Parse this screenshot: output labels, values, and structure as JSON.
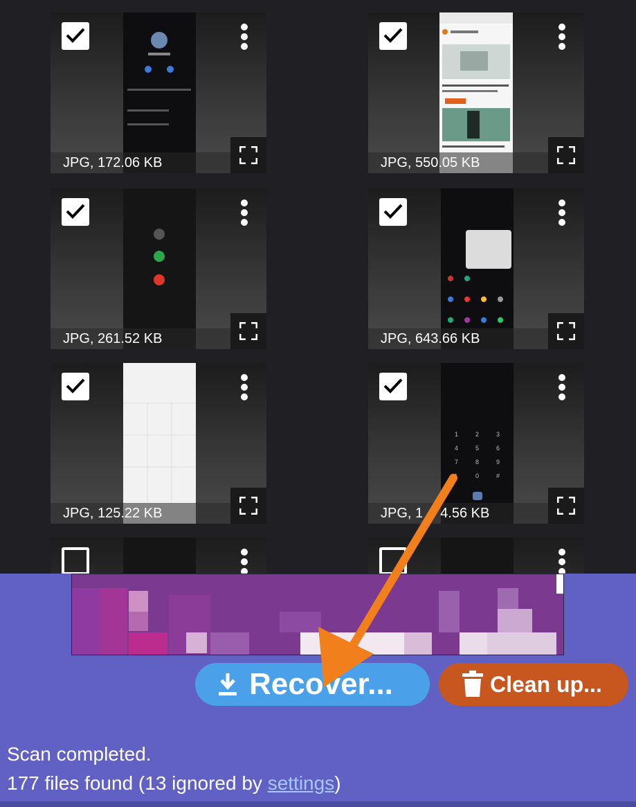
{
  "files": [
    {
      "label": "JPG, 172.06 KB",
      "checked": true,
      "thumb": "dark"
    },
    {
      "label": "JPG, 550.05 KB",
      "checked": true,
      "thumb": "web"
    },
    {
      "label": "JPG, 261.52 KB",
      "checked": true,
      "thumb": "dark"
    },
    {
      "label": "JPG, 643.66 KB",
      "checked": true,
      "thumb": "dark"
    },
    {
      "label": "JPG, 125.22 KB",
      "checked": true,
      "thumb": "light"
    },
    {
      "label": "JPG, 1",
      "label_end": "4.56 KB",
      "checked": true,
      "thumb": "dark"
    },
    {
      "label": "",
      "checked": false,
      "thumb": "dark"
    },
    {
      "label": "",
      "checked": false,
      "thumb": "dark"
    }
  ],
  "actions": {
    "recover_label": "Recover...",
    "cleanup_label": "Clean up..."
  },
  "status": {
    "line1": "Scan completed.",
    "line2_prefix": "177 files found (13 ignored by ",
    "line2_link": "settings",
    "line2_suffix": ")"
  },
  "colors": {
    "panel": "#6161c3",
    "recover_button": "#4ba0ea",
    "cleanup_button": "#c8571f",
    "annotation_arrow": "#f07f1c"
  },
  "icons": {
    "checkbox": "checkmark-icon",
    "menu": "more-vert-icon",
    "expand": "fullscreen-icon",
    "recover": "download-icon",
    "cleanup": "trash-icon"
  }
}
